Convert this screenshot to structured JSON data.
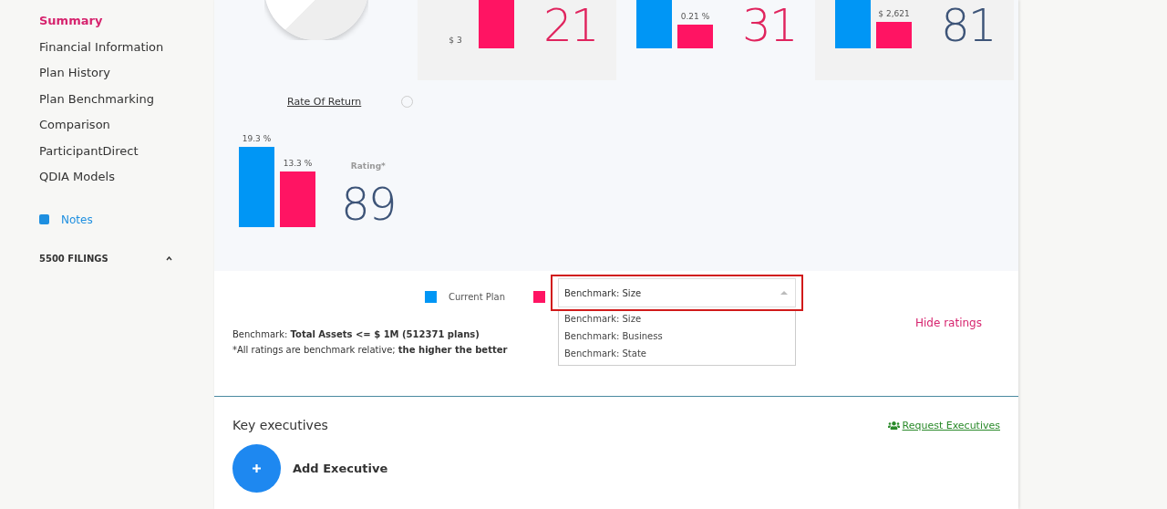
{
  "sidebar": {
    "items": [
      {
        "label": "Summary",
        "selected": true
      },
      {
        "label": "Financial Information",
        "selected": false
      },
      {
        "label": "Plan History",
        "selected": false
      },
      {
        "label": "Plan Benchmarking",
        "selected": false
      },
      {
        "label": "Comparison",
        "selected": false
      },
      {
        "label": "ParticipantDirect",
        "selected": false
      },
      {
        "label": "QDIA Models",
        "selected": false
      }
    ],
    "notes": {
      "label": "Notes"
    },
    "section": {
      "label": "5500 FILINGS",
      "expanded": true
    }
  },
  "metrics": [
    {
      "current_label": "$ 3",
      "rating": "21",
      "color": "#e0245e"
    },
    {
      "benchmark_label": "0.21 %",
      "rating": "31",
      "color": "#e0245e"
    },
    {
      "benchmark_label": "$ 2,621",
      "rating": "81",
      "color": "#3d5478"
    }
  ],
  "rate_of_return": {
    "title": "Rate Of Return",
    "bars": [
      {
        "label": "19.3 %"
      },
      {
        "label": "13.3 %"
      }
    ],
    "rating_label": "Rating*",
    "rating": "89",
    "color": "#3d5478"
  },
  "legend": {
    "current": "Current Plan",
    "benchmark_select": {
      "value": "Benchmark: Size",
      "expanded": true,
      "options": [
        "Benchmark: Size",
        "Benchmark: Business",
        "Benchmark: State"
      ]
    }
  },
  "hide_ratings": "Hide ratings",
  "notes_text": [
    "Benchmark: **Total Assets <= $ 1M (512371 plans)**",
    "*All ratings are benchmark relative; **the higher the better**"
  ],
  "executives": {
    "title": "Key executives",
    "request_link": "Request Executives",
    "add_label": "Add Executive"
  }
}
